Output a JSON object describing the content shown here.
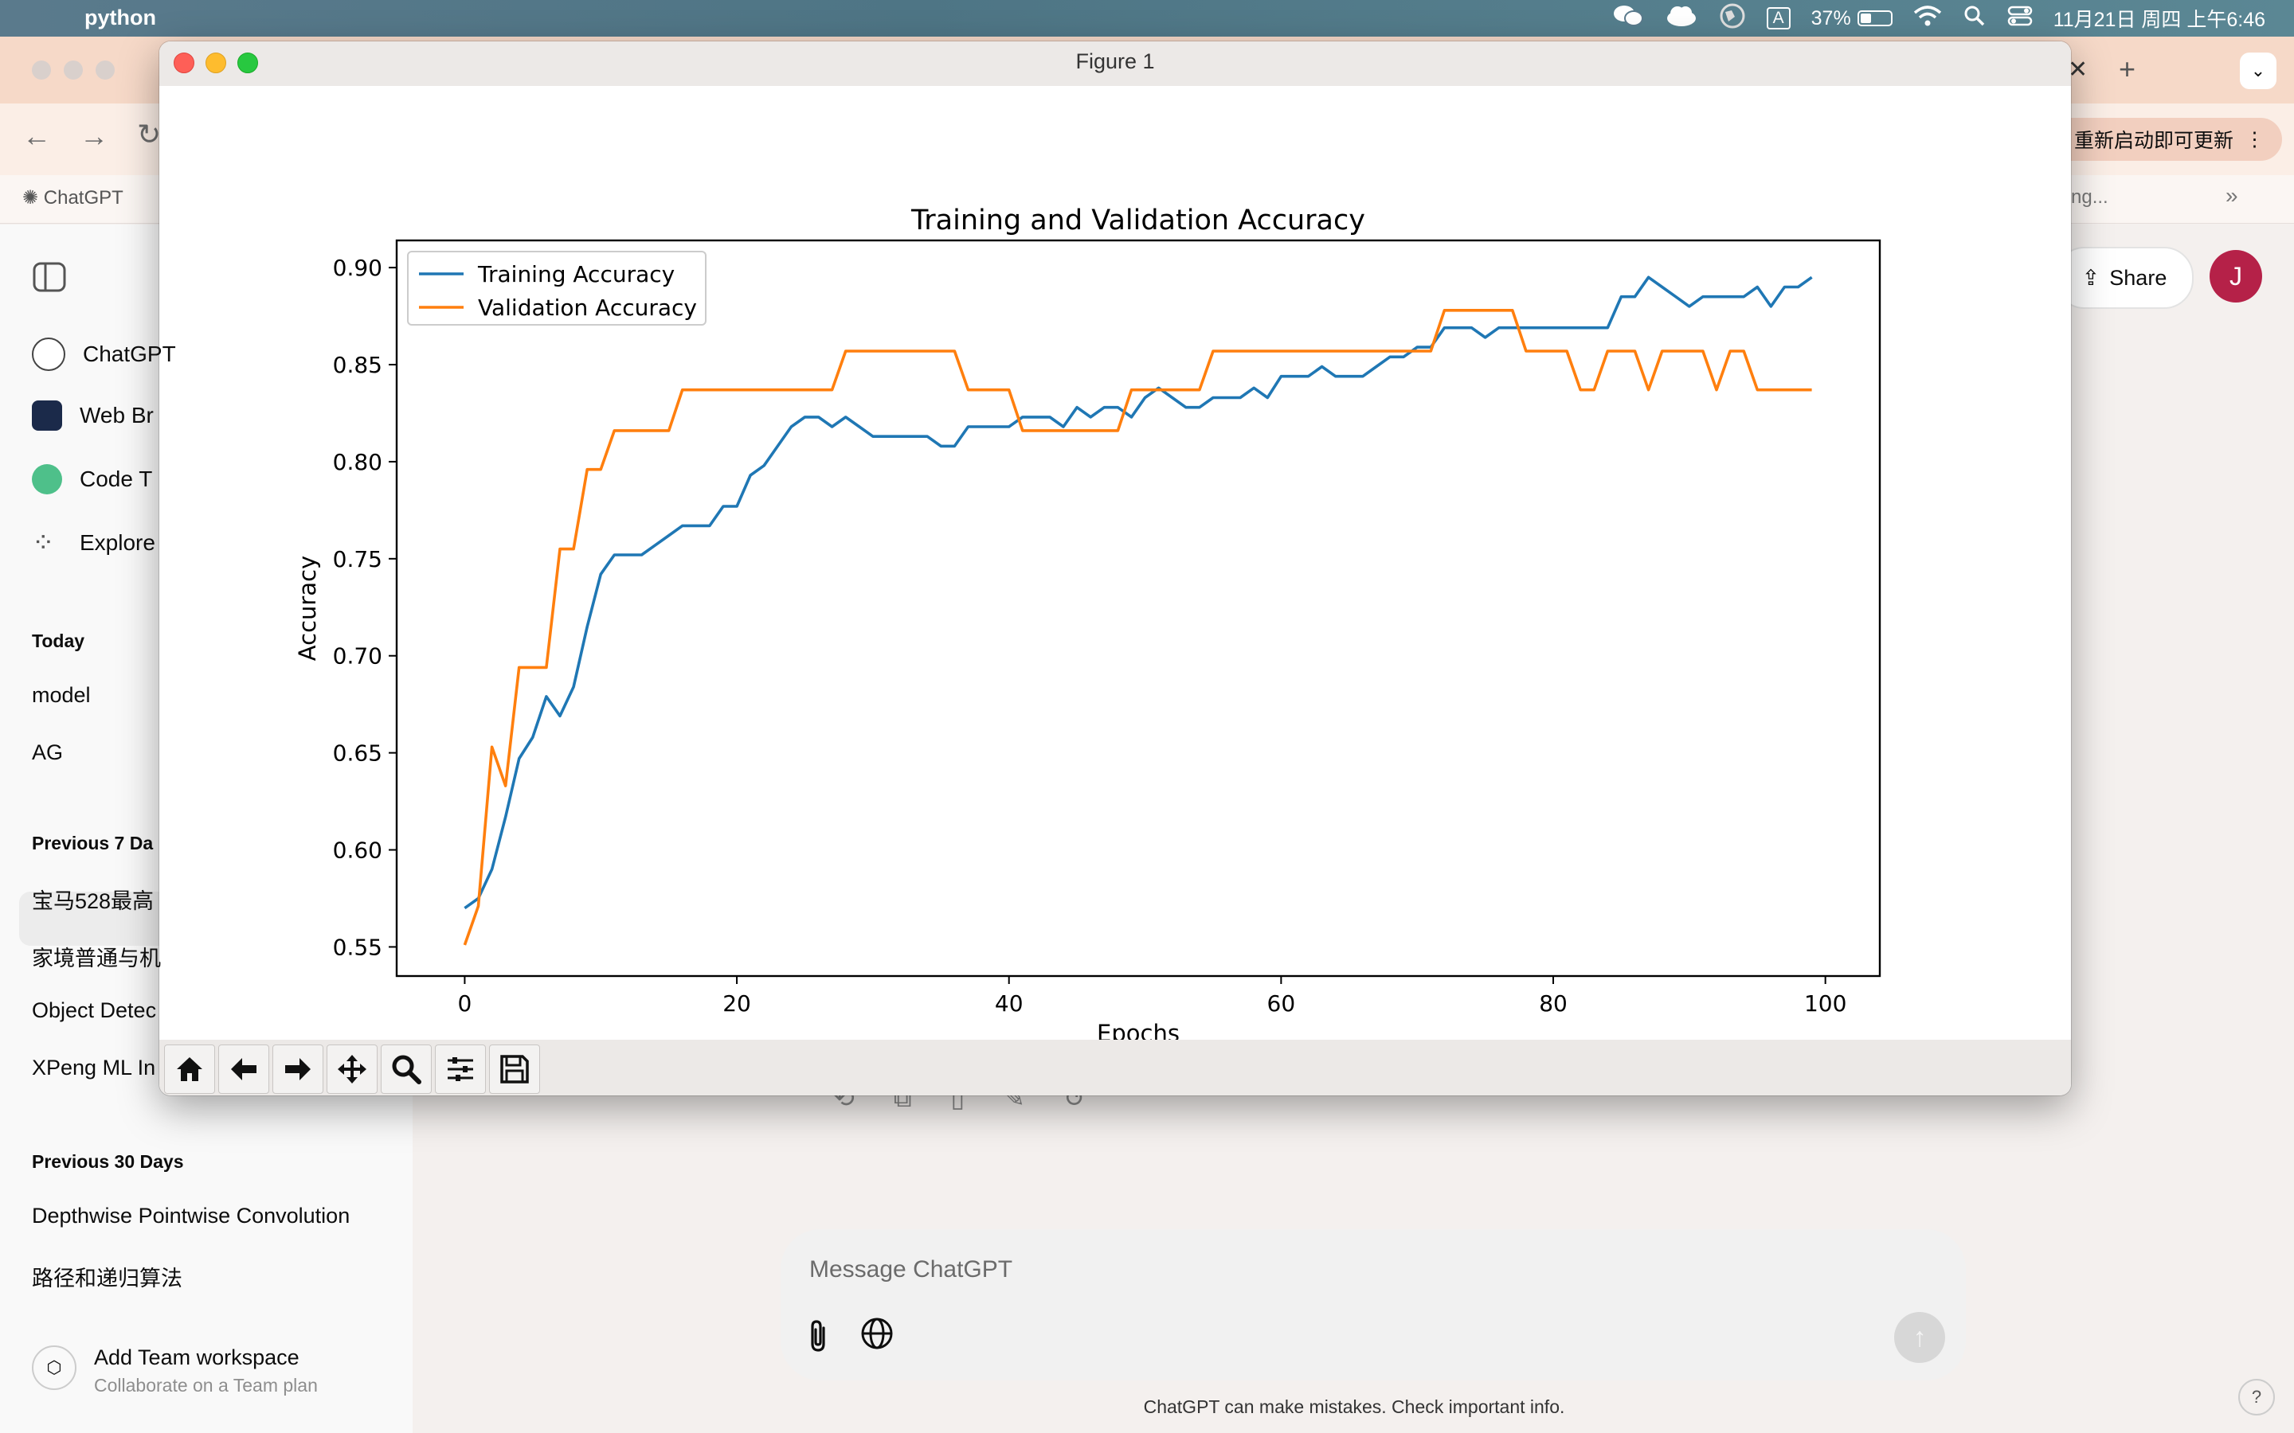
{
  "menubar": {
    "app_name": "python",
    "battery": "37%",
    "datetime": "11月21日 周四 上午6:46",
    "input_method": "A",
    "battery_level": 0.37
  },
  "browser": {
    "update_label": "重新启动即可更新",
    "bookmark_chatgpt": "ChatGPT",
    "bookmark_right": "ng..."
  },
  "sidebar": {
    "gpts": [
      {
        "label": "ChatGPT",
        "icon": "openai-icon"
      },
      {
        "label": "Web Br",
        "icon": "web-browser-icon"
      },
      {
        "label": "Code T",
        "icon": "code-tutor-icon"
      },
      {
        "label": "Explore",
        "icon": "grid-icon"
      }
    ],
    "today_heading": "Today",
    "today": [
      "model",
      "AG"
    ],
    "prev7_heading": "Previous 7 Da",
    "prev7": [
      "宝马528最高",
      "家境普通与机",
      "Object Detec",
      "XPeng ML In"
    ],
    "prev30_heading": "Previous 30 Days",
    "prev30": [
      "Depthwise Pointwise Convolution",
      "路径和递归算法"
    ],
    "team_title": "Add Team workspace",
    "team_subtitle": "Collaborate on a Team plan"
  },
  "main": {
    "share_label": "Share",
    "avatar_letter": "J",
    "composer_placeholder": "Message ChatGPT",
    "disclaimer": "ChatGPT can make mistakes. Check important info.",
    "help": "?"
  },
  "figure": {
    "window_title": "Figure 1"
  },
  "chart_data": {
    "type": "line",
    "title": "Training and Validation Accuracy",
    "xlabel": "Epochs",
    "ylabel": "Accuracy",
    "xlim": [
      -5,
      104
    ],
    "ylim": [
      0.535,
      0.914
    ],
    "xticks": [
      0,
      20,
      40,
      60,
      80,
      100
    ],
    "yticks": [
      0.55,
      0.6,
      0.65,
      0.7,
      0.75,
      0.8,
      0.85,
      0.9
    ],
    "xtick_labels": [
      "0",
      "20",
      "40",
      "60",
      "80",
      "100"
    ],
    "ytick_labels": [
      "0.55",
      "0.60",
      "0.65",
      "0.70",
      "0.75",
      "0.80",
      "0.85",
      "0.90"
    ],
    "legend_position": "upper left",
    "grid": false,
    "series": [
      {
        "name": "Training Accuracy",
        "color": "#1f77b4",
        "values": [
          0.57,
          0.575,
          0.59,
          0.617,
          0.647,
          0.658,
          0.679,
          0.669,
          0.684,
          0.715,
          0.742,
          0.752,
          0.752,
          0.752,
          0.757,
          0.762,
          0.767,
          0.767,
          0.767,
          0.777,
          0.777,
          0.793,
          0.798,
          0.808,
          0.818,
          0.823,
          0.823,
          0.818,
          0.823,
          0.818,
          0.813,
          0.813,
          0.813,
          0.813,
          0.813,
          0.808,
          0.808,
          0.818,
          0.818,
          0.818,
          0.818,
          0.823,
          0.823,
          0.823,
          0.818,
          0.828,
          0.823,
          0.828,
          0.828,
          0.823,
          0.833,
          0.838,
          0.833,
          0.828,
          0.828,
          0.833,
          0.833,
          0.833,
          0.838,
          0.833,
          0.844,
          0.844,
          0.844,
          0.849,
          0.844,
          0.844,
          0.844,
          0.849,
          0.854,
          0.854,
          0.859,
          0.859,
          0.869,
          0.869,
          0.869,
          0.864,
          0.869,
          0.869,
          0.869,
          0.869,
          0.869,
          0.869,
          0.869,
          0.869,
          0.869,
          0.885,
          0.885,
          0.895,
          0.89,
          0.885,
          0.88,
          0.885,
          0.885,
          0.885,
          0.885,
          0.89,
          0.88,
          0.89,
          0.89,
          0.895
        ]
      },
      {
        "name": "Validation Accuracy",
        "color": "#ff7f0e",
        "values": [
          0.551,
          0.571,
          0.653,
          0.633,
          0.694,
          0.694,
          0.694,
          0.755,
          0.755,
          0.796,
          0.796,
          0.816,
          0.816,
          0.816,
          0.816,
          0.816,
          0.837,
          0.837,
          0.837,
          0.837,
          0.837,
          0.837,
          0.837,
          0.837,
          0.837,
          0.837,
          0.837,
          0.837,
          0.857,
          0.857,
          0.857,
          0.857,
          0.857,
          0.857,
          0.857,
          0.857,
          0.857,
          0.837,
          0.837,
          0.837,
          0.837,
          0.816,
          0.816,
          0.816,
          0.816,
          0.816,
          0.816,
          0.816,
          0.816,
          0.837,
          0.837,
          0.837,
          0.837,
          0.837,
          0.837,
          0.857,
          0.857,
          0.857,
          0.857,
          0.857,
          0.857,
          0.857,
          0.857,
          0.857,
          0.857,
          0.857,
          0.857,
          0.857,
          0.857,
          0.857,
          0.857,
          0.857,
          0.878,
          0.878,
          0.878,
          0.878,
          0.878,
          0.878,
          0.857,
          0.857,
          0.857,
          0.857,
          0.837,
          0.837,
          0.857,
          0.857,
          0.857,
          0.837,
          0.857,
          0.857,
          0.857,
          0.857,
          0.837,
          0.857,
          0.857,
          0.837,
          0.837,
          0.837,
          0.837,
          0.837
        ]
      }
    ]
  }
}
